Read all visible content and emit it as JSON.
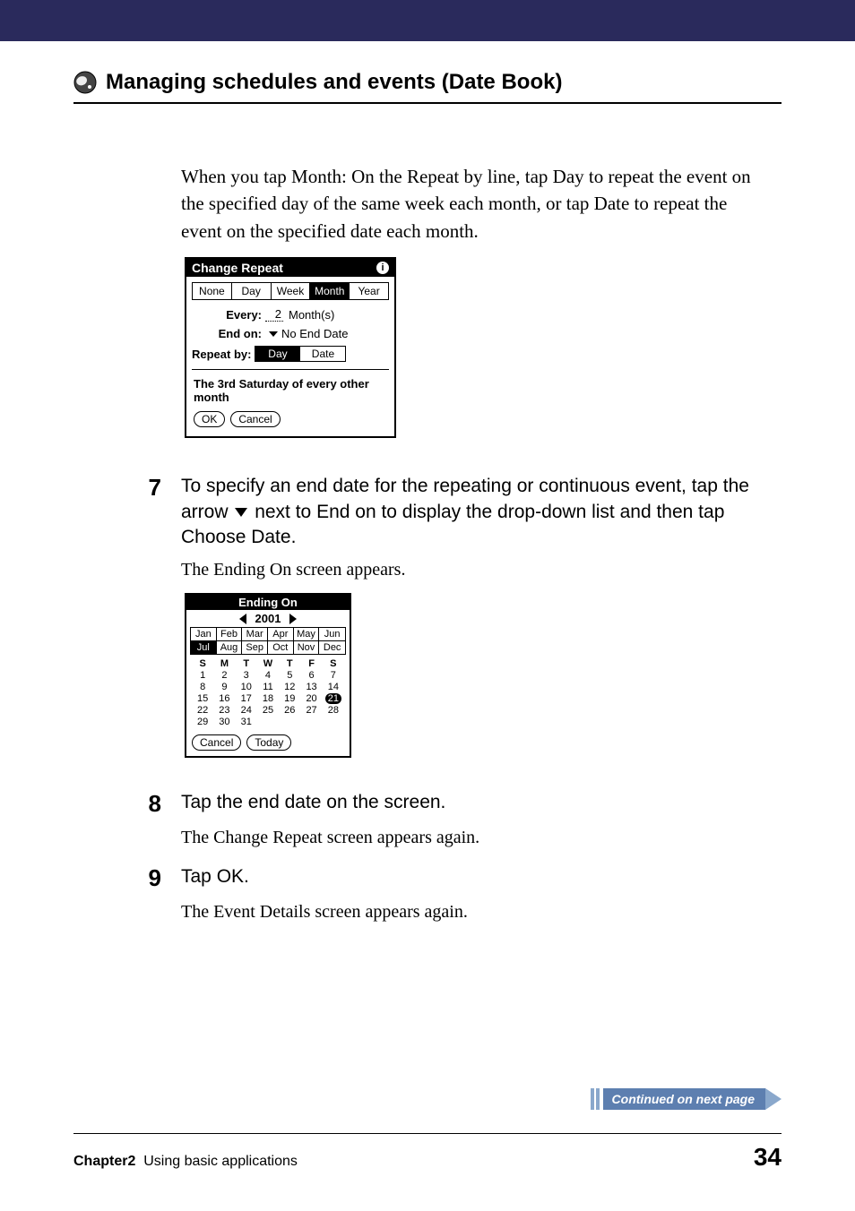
{
  "heading": "Managing schedules and events (Date Book)",
  "intro_text": "When you tap Month: On the Repeat by line, tap Day to repeat the event on the specified day of the same week each month, or tap Date to repeat the event on the specified date each month.",
  "change_repeat": {
    "title": "Change Repeat",
    "tabs": [
      "None",
      "Day",
      "Week",
      "Month",
      "Year"
    ],
    "selected_tab": "Month",
    "every_label": "Every:",
    "every_value": "2",
    "every_unit": "Month(s)",
    "end_on_label": "End on:",
    "end_on_value": "No End Date",
    "repeat_by_label": "Repeat by:",
    "repeat_by_options": [
      "Day",
      "Date"
    ],
    "repeat_by_selected": "Day",
    "summary": "The 3rd Saturday of every other month",
    "ok_label": "OK",
    "cancel_label": "Cancel"
  },
  "steps": {
    "s7": {
      "num": "7",
      "text_a": "To specify an end date for the repeating or continuous event, tap the arrow ",
      "text_b": " next to End on to display the drop-down list and then tap Choose Date.",
      "follow": "The Ending On screen appears."
    },
    "s8": {
      "num": "8",
      "text": "Tap the end date on the screen.",
      "follow": "The Change Repeat screen appears again."
    },
    "s9": {
      "num": "9",
      "text": "Tap OK.",
      "follow": "The Event Details screen appears again."
    }
  },
  "ending_on": {
    "title": "Ending On",
    "year": "2001",
    "months": [
      "Jan",
      "Feb",
      "Mar",
      "Apr",
      "May",
      "Jun",
      "Jul",
      "Aug",
      "Sep",
      "Oct",
      "Nov",
      "Dec"
    ],
    "selected_month": "Jul",
    "dow": [
      "S",
      "M",
      "T",
      "W",
      "T",
      "F",
      "S"
    ],
    "days": [
      [
        "1",
        "2",
        "3",
        "4",
        "5",
        "6",
        "7"
      ],
      [
        "8",
        "9",
        "10",
        "11",
        "12",
        "13",
        "14"
      ],
      [
        "15",
        "16",
        "17",
        "18",
        "19",
        "20",
        "21"
      ],
      [
        "22",
        "23",
        "24",
        "25",
        "26",
        "27",
        "28"
      ],
      [
        "29",
        "30",
        "31",
        "",
        "",
        "",
        ""
      ]
    ],
    "selected_day": "21",
    "cancel_label": "Cancel",
    "today_label": "Today"
  },
  "continued": "Continued on next page",
  "footer": {
    "chapter_label": "Chapter2",
    "chapter_title": "Using basic applications",
    "page": "34"
  }
}
